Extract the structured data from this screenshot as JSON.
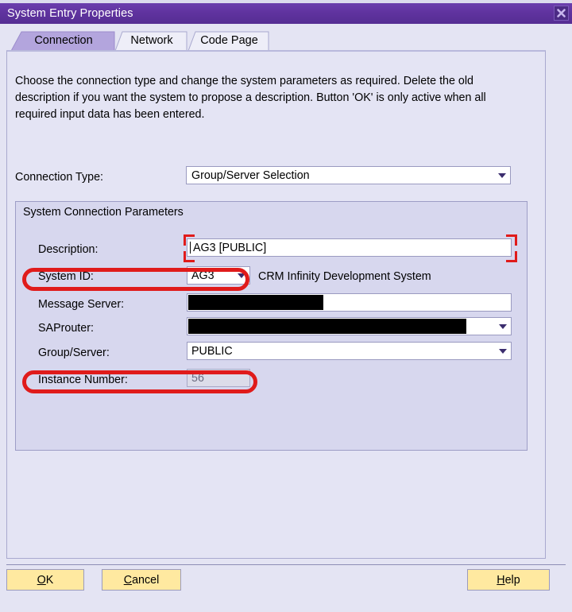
{
  "window": {
    "title": "System Entry Properties",
    "close_icon": "close-x-icon"
  },
  "tabs": [
    {
      "label": "Connection",
      "active": true
    },
    {
      "label": "Network",
      "active": false
    },
    {
      "label": "Code Page",
      "active": false
    }
  ],
  "panel": {
    "intro_text": "Choose the connection type and change the system parameters as required. Delete the old description if you want the system to propose a description. Button 'OK' is only active when all required input data has been entered.",
    "connection_type": {
      "label": "Connection Type:",
      "value": "Group/Server Selection",
      "arrow_icon": "chevron-down-icon"
    },
    "group": {
      "title": "System Connection Parameters",
      "fields": [
        {
          "label": "Description:",
          "value": "AG3 [PUBLIC]",
          "type": "text",
          "redacted": false,
          "disabled": false,
          "highlight": "corners"
        },
        {
          "label": "System ID:",
          "value": "AG3",
          "type": "dropdown",
          "redacted": false,
          "disabled": false,
          "highlight": "ring",
          "note": "CRM Infinity Development System"
        },
        {
          "label": "Message Server:",
          "value": "",
          "type": "text",
          "redacted": true,
          "disabled": false,
          "highlight": "none"
        },
        {
          "label": "SAProuter:",
          "value": "",
          "type": "dropdown",
          "redacted": true,
          "disabled": false,
          "highlight": "none"
        },
        {
          "label": "Group/Server:",
          "value": "PUBLIC",
          "type": "dropdown",
          "redacted": false,
          "disabled": false,
          "highlight": "none"
        },
        {
          "label": "Instance Number:",
          "value": "56",
          "type": "text",
          "redacted": false,
          "disabled": true,
          "highlight": "ring"
        }
      ]
    }
  },
  "footer": {
    "ok": {
      "prefix": "",
      "accel": "O",
      "suffix": "K"
    },
    "cancel": {
      "prefix": "",
      "accel": "C",
      "suffix": "ancel"
    },
    "help": {
      "prefix": "",
      "accel": "H",
      "suffix": "elp"
    }
  },
  "colors": {
    "titlebar": "#60339f",
    "panel_bg": "#e4e4f4",
    "group_bg": "#d7d7ee",
    "button_bg": "#ffe9a0",
    "annotation_red": "#e01b1b",
    "redaction": "#000000",
    "active_tab": "#b3a5dd"
  }
}
